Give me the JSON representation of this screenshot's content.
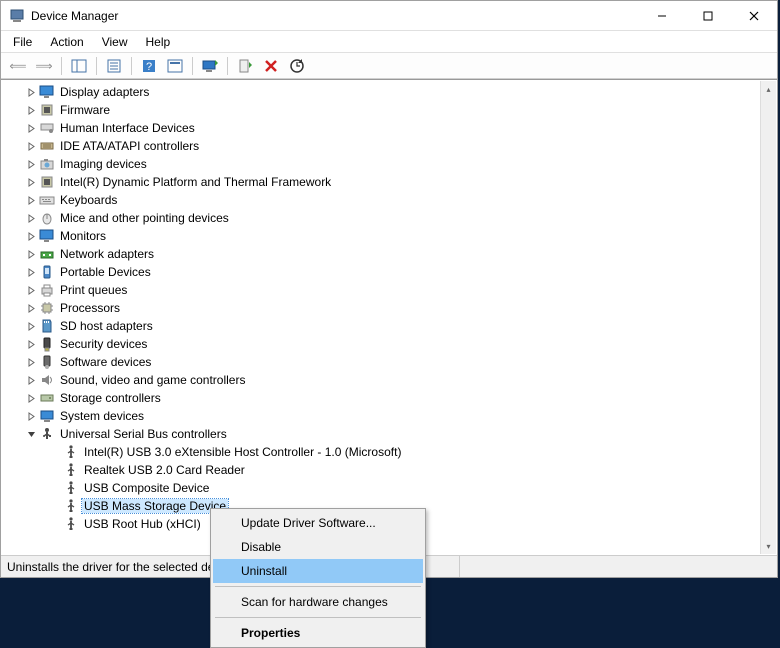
{
  "window": {
    "title": "Device Manager"
  },
  "menus": {
    "file": "File",
    "action": "Action",
    "view": "View",
    "help": "Help"
  },
  "tree": {
    "nodes": [
      {
        "label": "Display adapters",
        "icon": "monitor"
      },
      {
        "label": "Firmware",
        "icon": "chip"
      },
      {
        "label": "Human Interface Devices",
        "icon": "hid"
      },
      {
        "label": "IDE ATA/ATAPI controllers",
        "icon": "ide"
      },
      {
        "label": "Imaging devices",
        "icon": "camera"
      },
      {
        "label": "Intel(R) Dynamic Platform and Thermal Framework",
        "icon": "chip"
      },
      {
        "label": "Keyboards",
        "icon": "keyboard"
      },
      {
        "label": "Mice and other pointing devices",
        "icon": "mouse"
      },
      {
        "label": "Monitors",
        "icon": "monitor"
      },
      {
        "label": "Network adapters",
        "icon": "network"
      },
      {
        "label": "Portable Devices",
        "icon": "portable"
      },
      {
        "label": "Print queues",
        "icon": "printer"
      },
      {
        "label": "Processors",
        "icon": "cpu"
      },
      {
        "label": "SD host adapters",
        "icon": "sd"
      },
      {
        "label": "Security devices",
        "icon": "security"
      },
      {
        "label": "Software devices",
        "icon": "software"
      },
      {
        "label": "Sound, video and game controllers",
        "icon": "sound"
      },
      {
        "label": "Storage controllers",
        "icon": "storage"
      },
      {
        "label": "System devices",
        "icon": "system"
      }
    ],
    "usb": {
      "label": "Universal Serial Bus controllers",
      "children": [
        {
          "label": "Intel(R) USB 3.0 eXtensible Host Controller - 1.0 (Microsoft)"
        },
        {
          "label": "Realtek USB 2.0 Card Reader"
        },
        {
          "label": "USB Composite Device"
        },
        {
          "label": "USB Mass Storage Device",
          "selected": true
        },
        {
          "label": "USB Root Hub (xHCI)"
        }
      ]
    }
  },
  "context_menu": {
    "update": "Update Driver Software...",
    "disable": "Disable",
    "uninstall": "Uninstall",
    "scan": "Scan for hardware changes",
    "properties": "Properties"
  },
  "statusbar": {
    "text": "Uninstalls the driver for the selected device."
  }
}
